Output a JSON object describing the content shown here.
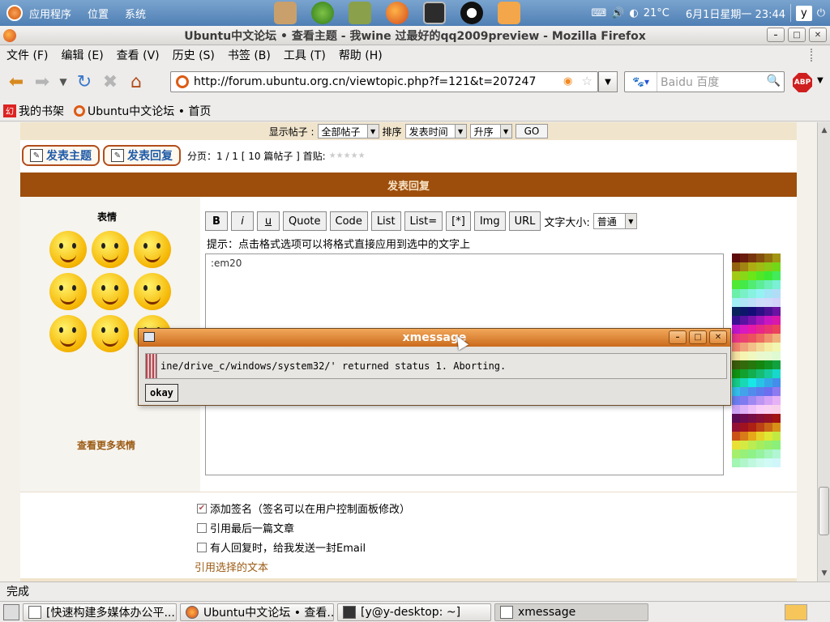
{
  "top_panel": {
    "menu": [
      "应用程序",
      "位置",
      "系统"
    ],
    "temperature": "21°C",
    "datetime": "6月1日星期一 23:44",
    "user": "y"
  },
  "firefox": {
    "title": "Ubuntu中文论坛 • 查看主题 - 我wine 过最好的qq2009preview - Mozilla Firefox",
    "menubar": [
      "文件 (F)",
      "编辑 (E)",
      "查看 (V)",
      "历史 (S)",
      "书签 (B)",
      "工具 (T)",
      "帮助 (H)"
    ],
    "url": "http://forum.ubuntu.org.cn/viewtopic.php?f=121&t=207247",
    "search_placeholder": "Baidu 百度",
    "abp_label": "ABP",
    "bookmarks": [
      "我的书架",
      "Ubuntu中文论坛 • 首页"
    ],
    "status": "完成"
  },
  "page": {
    "display_posts_label": "显示帖子 :",
    "display_posts_value": "全部帖子",
    "sort_label": "排序",
    "sort_value": "发表时间",
    "order_value": "升序",
    "go_label": "GO",
    "new_topic_label": "发表主题",
    "reply_label": "发表回复",
    "pagination": "分页：1 / 1  [ 10 篇帖子 ] 首贴:",
    "stars": "★★★★★",
    "reply_header": "发表回复",
    "emoticons_title": "表情",
    "more_emoticons": "查看更多表情",
    "format_buttons": [
      "B",
      "i",
      "u",
      "Quote",
      "Code",
      "List",
      "List=",
      "[*]",
      "Img",
      "URL"
    ],
    "font_size_label": "文字大小:",
    "font_size_value": "普通",
    "hint": "提示：点击格式选项可以将格式直接应用到选中的文字上",
    "textarea_value": ":em20",
    "options": [
      {
        "label": "添加签名（签名可以在用户控制面板修改）",
        "checked": true
      },
      {
        "label": "引用最后一篇文章",
        "checked": false
      },
      {
        "label": "有人回复时，给我发送一封Email",
        "checked": false
      }
    ],
    "quote_selected": "引用选择的文本"
  },
  "xmessage": {
    "title": "xmessage",
    "message": "ine/drive_c/windows/system32/' returned status 1.  Aborting.",
    "button": "okay"
  },
  "taskbar": [
    {
      "label": "[快速构建多媒体办公平...",
      "active": false
    },
    {
      "label": "Ubuntu中文论坛 • 查看...",
      "active": false
    },
    {
      "label": "[y@y-desktop: ~]",
      "active": false
    },
    {
      "label": "xmessage",
      "active": true
    }
  ],
  "colors": {
    "accent": "#9d4e0c",
    "panel": "#5a86b9",
    "link": "#1e5aa8"
  }
}
